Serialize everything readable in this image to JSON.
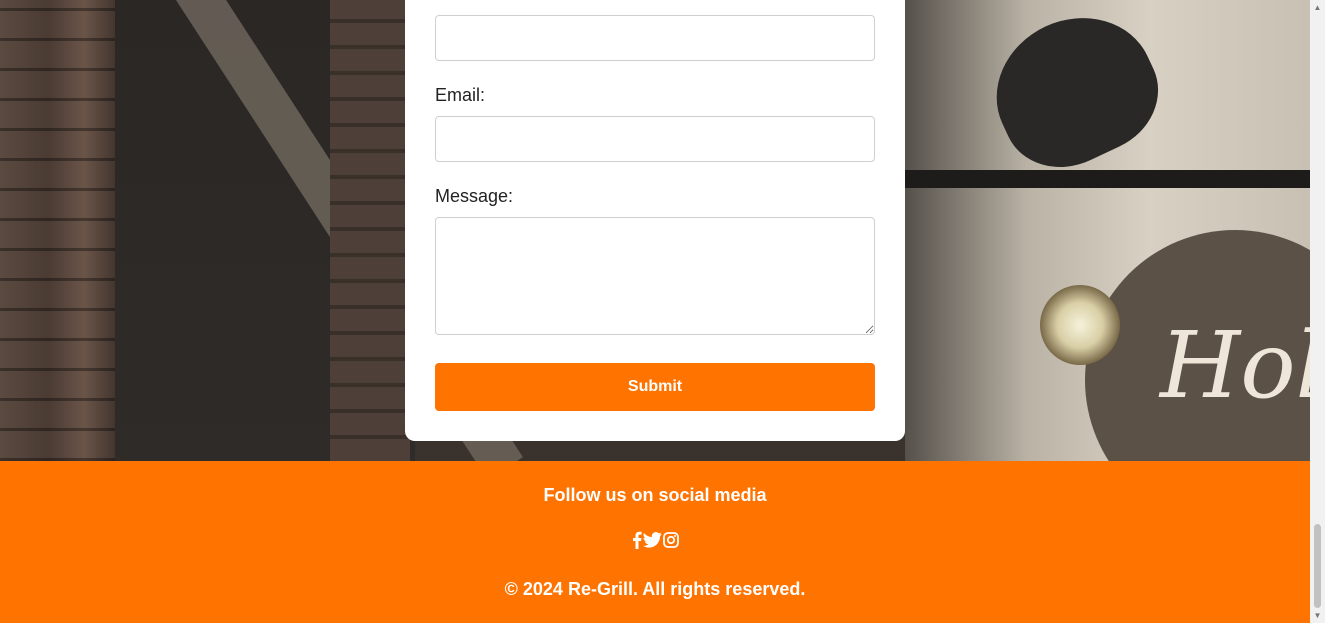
{
  "form": {
    "email_label": "Email:",
    "message_label": "Message:",
    "submit_label": "Submit"
  },
  "footer": {
    "follow_text": "Follow us on social media",
    "social_icons": [
      "facebook-icon",
      "twitter-icon",
      "instagram-icon"
    ],
    "copyright": "© 2024 Re-Grill. All rights reserved."
  },
  "background": {
    "sign_text": "Hols"
  },
  "colors": {
    "accent": "#ff7300",
    "card": "#ffffff"
  }
}
